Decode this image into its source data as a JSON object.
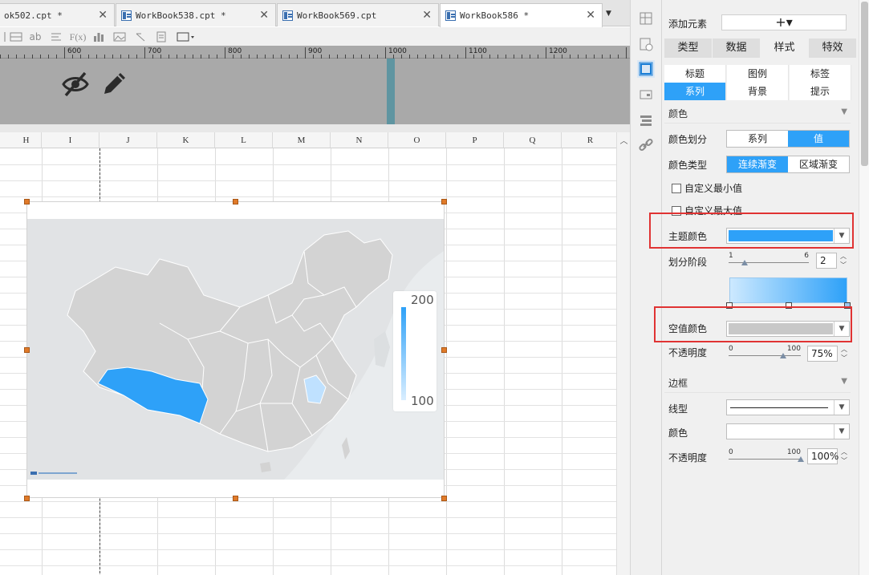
{
  "tabs": [
    {
      "label": "ok502.cpt *",
      "active": false
    },
    {
      "label": "WorkBook538.cpt *",
      "active": false
    },
    {
      "label": "WorkBook569.cpt",
      "active": false
    },
    {
      "label": "WorkBook586 *",
      "active": true
    }
  ],
  "tab_close_glyph": "✕",
  "tab_overflow_glyph": "▼",
  "toolbar": {
    "text_icon": "ab",
    "formula_icon": "F(x)"
  },
  "ruler": {
    "labels": [
      "600",
      "700",
      "800",
      "900",
      "1000",
      "1100",
      "1200"
    ]
  },
  "sheet": {
    "columns": [
      "H",
      "I",
      "J",
      "K",
      "L",
      "M",
      "N",
      "O",
      "P",
      "Q",
      "R"
    ]
  },
  "chart_data": {
    "type": "heatmap",
    "title": "",
    "legend_max": "200",
    "legend_min": "100",
    "legend_range": [
      100,
      200
    ],
    "highlighted_regions": [
      {
        "name": "Tibet",
        "level": "high"
      },
      {
        "name": "Shanghai area",
        "level": "low"
      }
    ],
    "colors": {
      "high": "#2ea1f8",
      "low": "#bfe1ff",
      "base": "#d3d3d3",
      "water": "#e9ecee"
    }
  },
  "panel": {
    "add_element_label": "添加元素",
    "add_element_button": "+▾",
    "main_tabs": [
      {
        "label": "类型",
        "active": false
      },
      {
        "label": "数据",
        "active": false
      },
      {
        "label": "样式",
        "active": true
      },
      {
        "label": "特效",
        "active": false
      }
    ],
    "sub_tabs": [
      {
        "label": "标题",
        "active": false
      },
      {
        "label": "图例",
        "active": false
      },
      {
        "label": "标签",
        "active": false
      },
      {
        "label": "系列",
        "active": true
      },
      {
        "label": "背景",
        "active": false
      },
      {
        "label": "提示",
        "active": false
      }
    ],
    "color_section": {
      "title": "颜色",
      "divide_label": "颜色划分",
      "divide_options": [
        {
          "label": "系列",
          "active": false
        },
        {
          "label": "值",
          "active": true
        }
      ],
      "type_label": "颜色类型",
      "type_options": [
        {
          "label": "连续渐变",
          "active": true
        },
        {
          "label": "区域渐变",
          "active": false
        }
      ],
      "custom_min_label": "自定义最小值",
      "custom_max_label": "自定义最大值",
      "theme_color_label": "主题颜色",
      "theme_color": "#2ea1f8",
      "stages_label": "划分阶段",
      "stages_slider_min": "1",
      "stages_slider_max": "6",
      "stages_value": "2",
      "stages_fraction": 0.2,
      "null_color_label": "空值颜色",
      "null_color": "#c8c8c8",
      "opacity_label": "不透明度",
      "opacity_slider_min": "0",
      "opacity_slider_max": "100",
      "opacity_value": "75%",
      "opacity_fraction": 0.75
    },
    "border_section": {
      "title": "边框",
      "line_type_label": "线型",
      "color_label": "颜色",
      "opacity_label": "不透明度",
      "opacity_slider_min": "0",
      "opacity_slider_max": "100",
      "opacity_value": "100%",
      "opacity_fraction": 1.0
    }
  },
  "colors": {
    "accent": "#2ea1f8",
    "highlight_border": "#e03333",
    "handle": "#e07a29"
  }
}
